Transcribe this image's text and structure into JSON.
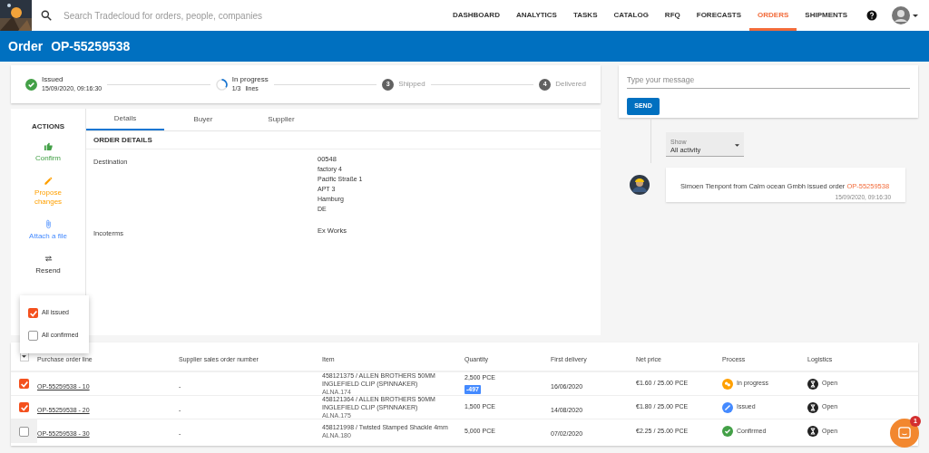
{
  "header": {
    "search_placeholder": "Search Tradecloud for orders, people, companies",
    "nav": [
      {
        "label": "DASHBOARD",
        "selected": false
      },
      {
        "label": "ANALYTICS",
        "selected": false
      },
      {
        "label": "TASKS",
        "selected": false
      },
      {
        "label": "CATALOG",
        "selected": false
      },
      {
        "label": "RFQ",
        "selected": false
      },
      {
        "label": "FORECASTS",
        "selected": false
      },
      {
        "label": "ORDERS",
        "selected": true
      },
      {
        "label": "SHIPMENTS",
        "selected": false
      }
    ]
  },
  "page_title": {
    "label": "Order",
    "number": "OP-55259538"
  },
  "stepper": [
    {
      "kind": "done",
      "label": "Issued",
      "detail": "15/09/2020, 09:16:30"
    },
    {
      "kind": "active",
      "label": "In progress",
      "count": "1/3",
      "detail": "lines"
    },
    {
      "kind": "pending",
      "number": "3",
      "label": "Shipped"
    },
    {
      "kind": "pending",
      "number": "4",
      "label": "Delivered"
    }
  ],
  "actions": {
    "title": "ACTIONS",
    "items": [
      {
        "kind": "confirm",
        "label": "Confirm"
      },
      {
        "kind": "propose",
        "label": "Propose changes"
      },
      {
        "kind": "attach",
        "label": "Attach a file"
      },
      {
        "kind": "resend",
        "label": "Resend"
      }
    ]
  },
  "tabs": [
    {
      "label": "Details",
      "selected": true
    },
    {
      "label": "Buyer",
      "selected": false
    },
    {
      "label": "Supplier",
      "selected": false
    }
  ],
  "order_details": {
    "title": "ORDER DETAILS",
    "fields": [
      {
        "label": "Destination",
        "value": "00548",
        "lines": [
          "factory 4",
          "Pacific Straße 1",
          "APT 3",
          "Hamburg",
          "DE"
        ]
      },
      {
        "label": "Incoterms",
        "value": "Ex Works"
      }
    ]
  },
  "message": {
    "placeholder": "Type your message",
    "button": "SEND"
  },
  "activity": {
    "filter": {
      "label": "Show",
      "value": "All activity"
    },
    "entries": [
      {
        "text": "Simoen Tienpont from Calm ocean Gmbh issued order ",
        "link": "OP-55259538",
        "time": "15/09/2020, 09:16:30"
      }
    ]
  },
  "select_menu": [
    {
      "label": "All issued",
      "checked": true
    },
    {
      "label": "All confirmed",
      "checked": false
    }
  ],
  "table": {
    "columns": [
      "Purchase order line",
      "Supplier sales order number",
      "Item",
      "Quantity",
      "First delivery",
      "Net price",
      "Process",
      "Logistics"
    ],
    "rows": [
      {
        "checked": true,
        "line": "OP-55259538 - 10",
        "supplier_number": "-",
        "item": "458121375 / ALLEN BROTHERS 50MM INGLEFIELD CLIP (SPINNAKER)",
        "item_code": "ALNA.174",
        "quantity": "2,500 PCE",
        "quantity_badge": "-497",
        "first_delivery": "16/06/2020",
        "price": "€1.60",
        "price_unit": "/ 25.00 PCE",
        "process": {
          "kind": "in_progress",
          "label": "In progress"
        },
        "logistics": "Open"
      },
      {
        "checked": true,
        "line": "OP-55259538 - 20",
        "supplier_number": "-",
        "item": "458121364 / ALLEN BROTHERS 50MM INGLEFIELD CLIP (SPINNAKER)",
        "item_code": "ALNA.175",
        "quantity": "1,500 PCE",
        "first_delivery": "14/08/2020",
        "price": "€1.80",
        "price_unit": "/ 25.00 PCE",
        "process": {
          "kind": "issued",
          "label": "Issued"
        },
        "logistics": "Open"
      },
      {
        "checked": false,
        "line": "OP-55259538 - 30",
        "supplier_number": "-",
        "item": "458121998 / Twisted Stamped Shackle 4mm",
        "item_code": "ALNA.180",
        "quantity": "5,000 PCE",
        "first_delivery": "07/02/2020",
        "price": "€2.25",
        "price_unit": "/ 25.00 PCE",
        "process": {
          "kind": "confirmed",
          "label": "Confirmed"
        },
        "logistics": "Open"
      }
    ]
  },
  "chat_launcher": {
    "badge": "1"
  }
}
